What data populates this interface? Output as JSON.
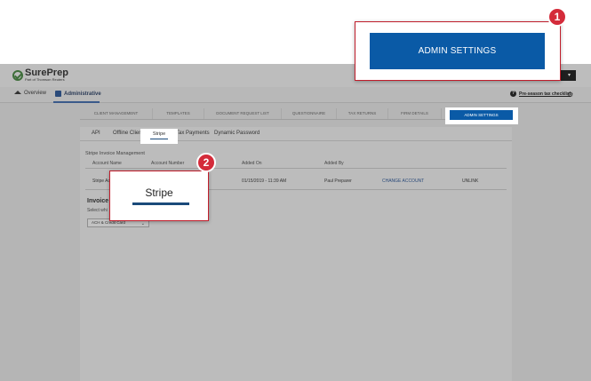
{
  "app": {
    "brand": "SurePrep",
    "brand_tagline": "Part of Thomson Reuters",
    "user_menu": "▾"
  },
  "nav": {
    "overview": "Overview",
    "administrative": "Administrative",
    "checklist_link": "Pre-season tax checklist"
  },
  "main_tabs": [
    "CLIENT MANAGEMENT",
    "TEMPLATES",
    "DOCUMENT REQUEST LIST",
    "QUESTIONNAIRE",
    "TAX RETURNS",
    "FIRM DETAILS",
    "ADMIN SETTINGS"
  ],
  "sub_tabs": {
    "api": "API",
    "offline_clients": "Offline Clients",
    "stripe": "Stripe",
    "tax_payments": "Tax Payments",
    "dynamic_password": "Dynamic Password"
  },
  "stripe_section": {
    "heading": "Stripe Invoice Management",
    "columns": [
      "Account Name",
      "Account Number",
      "Added On",
      "Added By"
    ],
    "row": {
      "account_name": "Stripe Ac",
      "added_on": "01/15/2019 - 11:39 AM",
      "added_by": "Paul Preparer",
      "change_action": "CHANGE ACCOUNT",
      "unlink_action": "UNLINK"
    }
  },
  "invoice": {
    "title": "Invoice C",
    "subtitle": "Select whi",
    "select_value": "ACH & Credit Card"
  },
  "callouts": {
    "admin_settings": "ADMIN SETTINGS",
    "admin_badge": "1",
    "stripe": "Stripe",
    "stripe_badge": "2"
  },
  "colors": {
    "accent_blue": "#0a5aa6",
    "callout_red": "#d42b3a",
    "dim_gray": "#b5b5b5"
  }
}
